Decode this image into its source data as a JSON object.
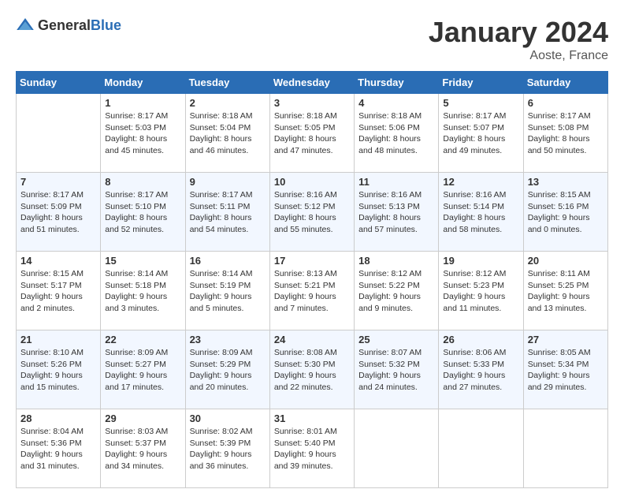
{
  "header": {
    "logo_general": "General",
    "logo_blue": "Blue",
    "title": "January 2024",
    "location": "Aoste, France"
  },
  "columns": [
    "Sunday",
    "Monday",
    "Tuesday",
    "Wednesday",
    "Thursday",
    "Friday",
    "Saturday"
  ],
  "weeks": [
    [
      {
        "day": "",
        "sunrise": "",
        "sunset": "",
        "daylight": ""
      },
      {
        "day": "1",
        "sunrise": "Sunrise: 8:17 AM",
        "sunset": "Sunset: 5:03 PM",
        "daylight": "Daylight: 8 hours and 45 minutes."
      },
      {
        "day": "2",
        "sunrise": "Sunrise: 8:18 AM",
        "sunset": "Sunset: 5:04 PM",
        "daylight": "Daylight: 8 hours and 46 minutes."
      },
      {
        "day": "3",
        "sunrise": "Sunrise: 8:18 AM",
        "sunset": "Sunset: 5:05 PM",
        "daylight": "Daylight: 8 hours and 47 minutes."
      },
      {
        "day": "4",
        "sunrise": "Sunrise: 8:18 AM",
        "sunset": "Sunset: 5:06 PM",
        "daylight": "Daylight: 8 hours and 48 minutes."
      },
      {
        "day": "5",
        "sunrise": "Sunrise: 8:17 AM",
        "sunset": "Sunset: 5:07 PM",
        "daylight": "Daylight: 8 hours and 49 minutes."
      },
      {
        "day": "6",
        "sunrise": "Sunrise: 8:17 AM",
        "sunset": "Sunset: 5:08 PM",
        "daylight": "Daylight: 8 hours and 50 minutes."
      }
    ],
    [
      {
        "day": "7",
        "sunrise": "Sunrise: 8:17 AM",
        "sunset": "Sunset: 5:09 PM",
        "daylight": "Daylight: 8 hours and 51 minutes."
      },
      {
        "day": "8",
        "sunrise": "Sunrise: 8:17 AM",
        "sunset": "Sunset: 5:10 PM",
        "daylight": "Daylight: 8 hours and 52 minutes."
      },
      {
        "day": "9",
        "sunrise": "Sunrise: 8:17 AM",
        "sunset": "Sunset: 5:11 PM",
        "daylight": "Daylight: 8 hours and 54 minutes."
      },
      {
        "day": "10",
        "sunrise": "Sunrise: 8:16 AM",
        "sunset": "Sunset: 5:12 PM",
        "daylight": "Daylight: 8 hours and 55 minutes."
      },
      {
        "day": "11",
        "sunrise": "Sunrise: 8:16 AM",
        "sunset": "Sunset: 5:13 PM",
        "daylight": "Daylight: 8 hours and 57 minutes."
      },
      {
        "day": "12",
        "sunrise": "Sunrise: 8:16 AM",
        "sunset": "Sunset: 5:14 PM",
        "daylight": "Daylight: 8 hours and 58 minutes."
      },
      {
        "day": "13",
        "sunrise": "Sunrise: 8:15 AM",
        "sunset": "Sunset: 5:16 PM",
        "daylight": "Daylight: 9 hours and 0 minutes."
      }
    ],
    [
      {
        "day": "14",
        "sunrise": "Sunrise: 8:15 AM",
        "sunset": "Sunset: 5:17 PM",
        "daylight": "Daylight: 9 hours and 2 minutes."
      },
      {
        "day": "15",
        "sunrise": "Sunrise: 8:14 AM",
        "sunset": "Sunset: 5:18 PM",
        "daylight": "Daylight: 9 hours and 3 minutes."
      },
      {
        "day": "16",
        "sunrise": "Sunrise: 8:14 AM",
        "sunset": "Sunset: 5:19 PM",
        "daylight": "Daylight: 9 hours and 5 minutes."
      },
      {
        "day": "17",
        "sunrise": "Sunrise: 8:13 AM",
        "sunset": "Sunset: 5:21 PM",
        "daylight": "Daylight: 9 hours and 7 minutes."
      },
      {
        "day": "18",
        "sunrise": "Sunrise: 8:12 AM",
        "sunset": "Sunset: 5:22 PM",
        "daylight": "Daylight: 9 hours and 9 minutes."
      },
      {
        "day": "19",
        "sunrise": "Sunrise: 8:12 AM",
        "sunset": "Sunset: 5:23 PM",
        "daylight": "Daylight: 9 hours and 11 minutes."
      },
      {
        "day": "20",
        "sunrise": "Sunrise: 8:11 AM",
        "sunset": "Sunset: 5:25 PM",
        "daylight": "Daylight: 9 hours and 13 minutes."
      }
    ],
    [
      {
        "day": "21",
        "sunrise": "Sunrise: 8:10 AM",
        "sunset": "Sunset: 5:26 PM",
        "daylight": "Daylight: 9 hours and 15 minutes."
      },
      {
        "day": "22",
        "sunrise": "Sunrise: 8:09 AM",
        "sunset": "Sunset: 5:27 PM",
        "daylight": "Daylight: 9 hours and 17 minutes."
      },
      {
        "day": "23",
        "sunrise": "Sunrise: 8:09 AM",
        "sunset": "Sunset: 5:29 PM",
        "daylight": "Daylight: 9 hours and 20 minutes."
      },
      {
        "day": "24",
        "sunrise": "Sunrise: 8:08 AM",
        "sunset": "Sunset: 5:30 PM",
        "daylight": "Daylight: 9 hours and 22 minutes."
      },
      {
        "day": "25",
        "sunrise": "Sunrise: 8:07 AM",
        "sunset": "Sunset: 5:32 PM",
        "daylight": "Daylight: 9 hours and 24 minutes."
      },
      {
        "day": "26",
        "sunrise": "Sunrise: 8:06 AM",
        "sunset": "Sunset: 5:33 PM",
        "daylight": "Daylight: 9 hours and 27 minutes."
      },
      {
        "day": "27",
        "sunrise": "Sunrise: 8:05 AM",
        "sunset": "Sunset: 5:34 PM",
        "daylight": "Daylight: 9 hours and 29 minutes."
      }
    ],
    [
      {
        "day": "28",
        "sunrise": "Sunrise: 8:04 AM",
        "sunset": "Sunset: 5:36 PM",
        "daylight": "Daylight: 9 hours and 31 minutes."
      },
      {
        "day": "29",
        "sunrise": "Sunrise: 8:03 AM",
        "sunset": "Sunset: 5:37 PM",
        "daylight": "Daylight: 9 hours and 34 minutes."
      },
      {
        "day": "30",
        "sunrise": "Sunrise: 8:02 AM",
        "sunset": "Sunset: 5:39 PM",
        "daylight": "Daylight: 9 hours and 36 minutes."
      },
      {
        "day": "31",
        "sunrise": "Sunrise: 8:01 AM",
        "sunset": "Sunset: 5:40 PM",
        "daylight": "Daylight: 9 hours and 39 minutes."
      },
      {
        "day": "",
        "sunrise": "",
        "sunset": "",
        "daylight": ""
      },
      {
        "day": "",
        "sunrise": "",
        "sunset": "",
        "daylight": ""
      },
      {
        "day": "",
        "sunrise": "",
        "sunset": "",
        "daylight": ""
      }
    ]
  ]
}
